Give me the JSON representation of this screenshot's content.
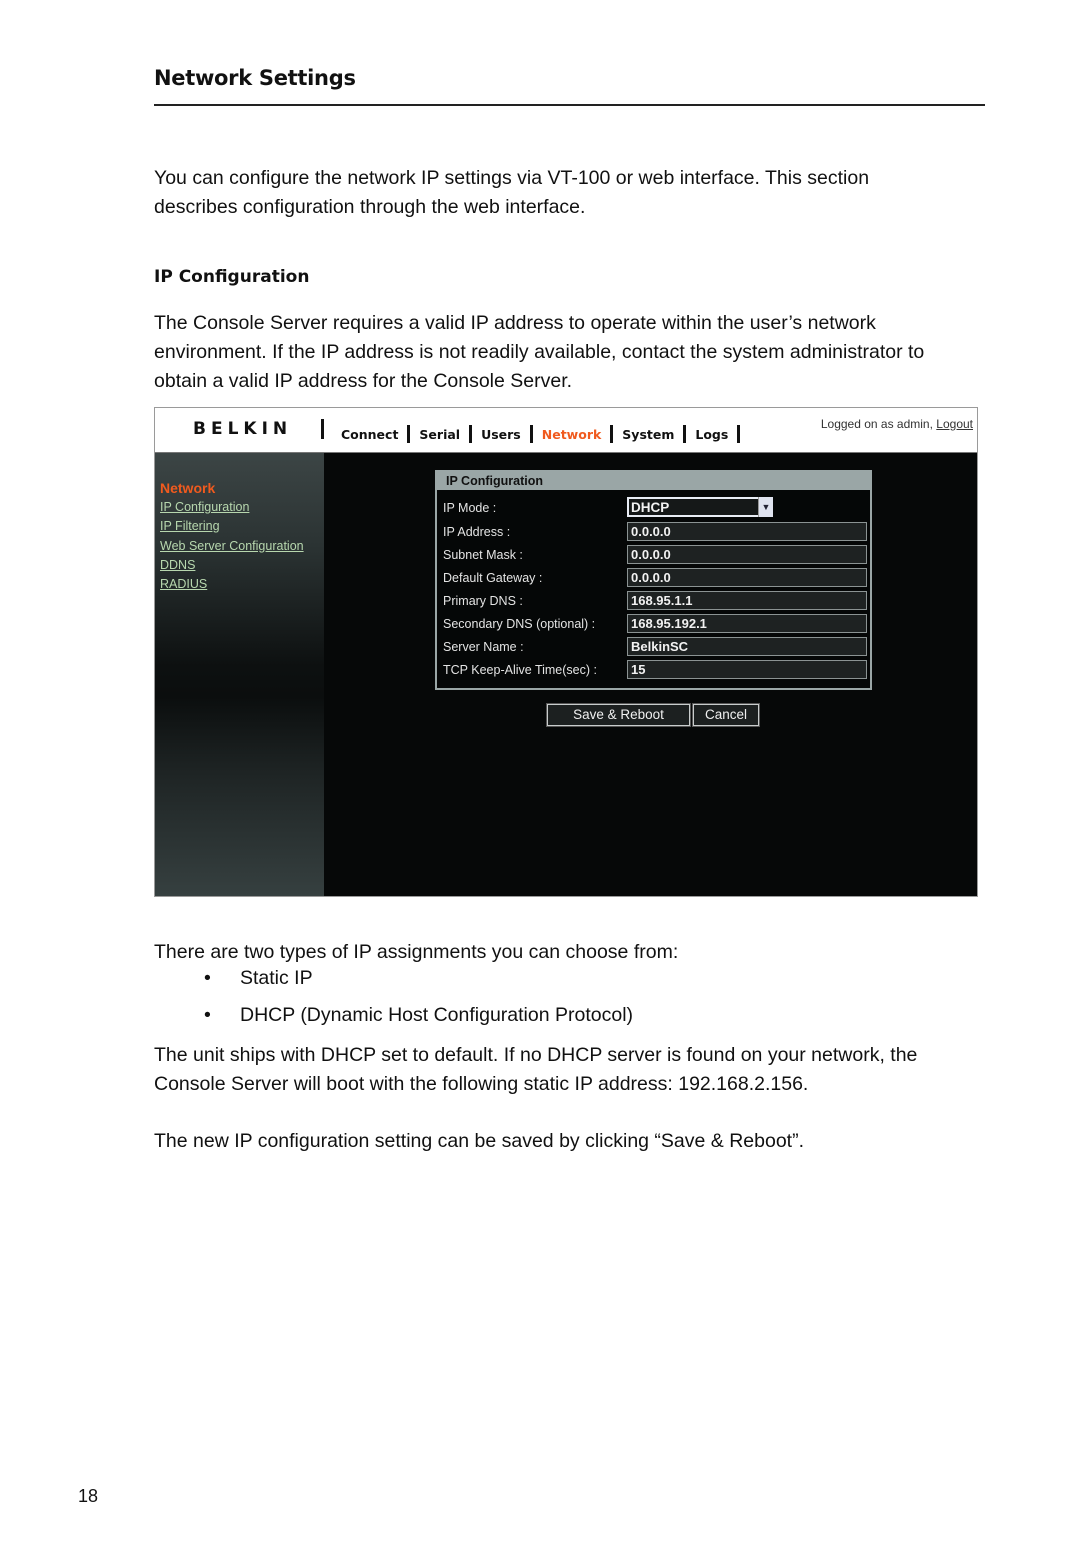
{
  "doc": {
    "title": "Network Settings",
    "intro": "You can configure the network IP settings via VT-100 or web interface. This section describes configuration through the web interface.",
    "section_heading": "IP Configuration",
    "section_para": "The Console Server requires a valid IP address to operate within the user’s network environment. If the IP address is not readily available, contact the system administrator to obtain a valid IP address for the Console Server.",
    "types_intro": "There are two types of IP assignments you can choose from:",
    "bullets": [
      {
        "symbol": "•",
        "text": "Static IP"
      },
      {
        "symbol": "•",
        "text": "DHCP (Dynamic Host Configuration Protocol)"
      }
    ],
    "default_para": "The unit ships with DHCP set to default. If no DHCP server is found on your network, the Console Server will boot with the following static IP address: 192.168.2.156.",
    "save_para": "The new IP configuration setting can be saved by clicking “Save & Reboot”.",
    "page_number": "18"
  },
  "screenshot": {
    "logo": "BELKIN",
    "nav": [
      {
        "label": "Connect",
        "active": false
      },
      {
        "label": "Serial",
        "active": false
      },
      {
        "label": "Users",
        "active": false
      },
      {
        "label": "Network",
        "active": true
      },
      {
        "label": "System",
        "active": false
      },
      {
        "label": "Logs",
        "active": false
      }
    ],
    "logged_text": "Logged on as admin,",
    "logout_label": "Logout",
    "sidebar": {
      "heading": "Network",
      "links": [
        "IP Configuration",
        "IP Filtering",
        "Web Server Configuration",
        "DDNS",
        "RADIUS"
      ]
    },
    "panel": {
      "title": "IP Configuration",
      "ip_mode": {
        "label": "IP Mode :",
        "value": "DHCP",
        "icon": "chevron-down-icon"
      },
      "fields": [
        {
          "label": "IP Address :",
          "value": "0.0.0.0"
        },
        {
          "label": "Subnet Mask :",
          "value": "0.0.0.0"
        },
        {
          "label": "Default Gateway :",
          "value": "0.0.0.0"
        },
        {
          "label": "Primary DNS :",
          "value": "168.95.1.1"
        },
        {
          "label": "Secondary DNS (optional) :",
          "value": "168.95.192.1"
        },
        {
          "label": "Server Name :",
          "value": "BelkinSC"
        },
        {
          "label": "TCP Keep-Alive Time(sec) :",
          "value": "15"
        }
      ]
    },
    "buttons": {
      "save": "Save & Reboot",
      "cancel": "Cancel"
    },
    "colors": {
      "accent": "#f05a1e",
      "link": "#b7d7ae",
      "panel_border": "#9aa6a6",
      "background": "#060808"
    }
  }
}
